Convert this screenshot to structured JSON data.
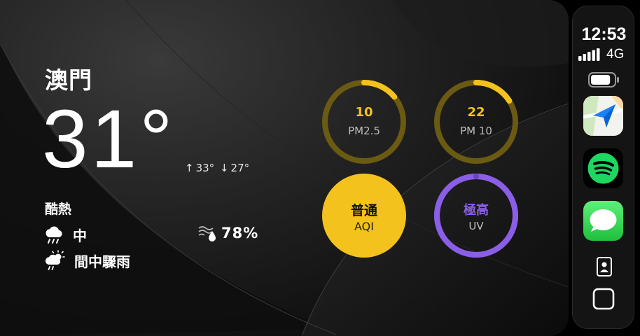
{
  "weather": {
    "city": "澳門",
    "temperature": "31°",
    "high": "33°",
    "low": "27°",
    "condition": "酷熱",
    "rain_level": "中",
    "humidity": "78%",
    "forecast": "間中驟雨"
  },
  "gauges": [
    {
      "value": "10",
      "label": "PM2.5",
      "fraction": 0.14,
      "color": "#f4c21c",
      "track": "#6b5a12"
    },
    {
      "value": "22",
      "label": "PM 10",
      "fraction": 0.16,
      "color": "#f4c21c",
      "track": "#6b5a12"
    },
    {
      "value": "普通",
      "label": "AQI",
      "fraction": 1.0,
      "color": "#f4c21c",
      "track": "#f4c21c"
    },
    {
      "value": "極高",
      "label": "UV",
      "fraction": 1.0,
      "color": "#8a5ee6",
      "track": "#8a5ee6"
    }
  ],
  "status": {
    "time": "12:53",
    "network": "4G",
    "battery_level": 0.85
  },
  "dock": {
    "apps": [
      {
        "name": "maps",
        "icon": "maps-icon"
      },
      {
        "name": "spotify",
        "icon": "spotify-icon"
      },
      {
        "name": "messages",
        "icon": "messages-icon"
      }
    ]
  },
  "colors": {
    "accent_yellow": "#f4c21c",
    "accent_purple": "#8a5ee6",
    "spotify_green": "#1ed760",
    "messages_green": "#34c759"
  }
}
